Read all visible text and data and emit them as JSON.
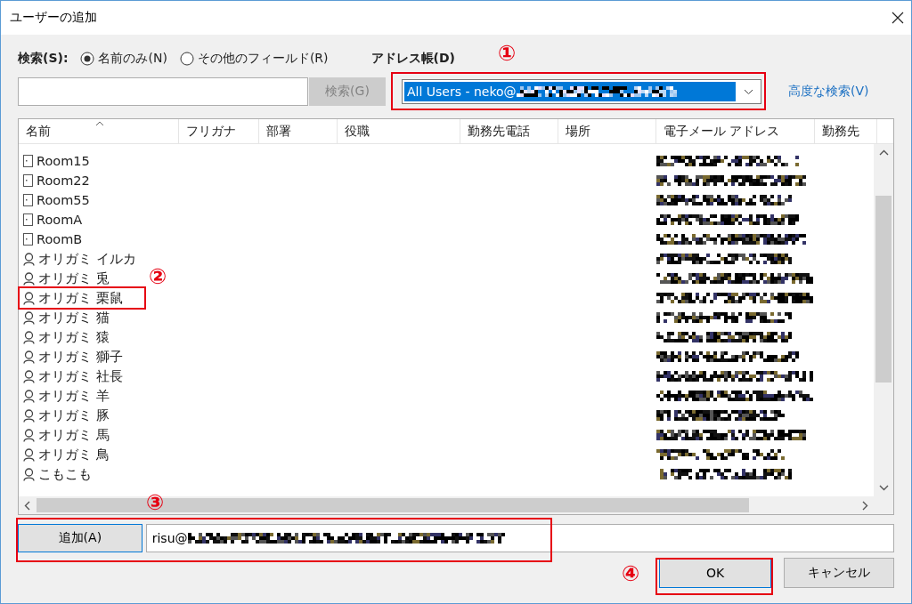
{
  "window": {
    "title": "ユーザーの追加"
  },
  "search": {
    "label": "検索(S):",
    "options": [
      {
        "label": "名前のみ(N)",
        "selected": true
      },
      {
        "label": "その他のフィールド(R)",
        "selected": false
      }
    ],
    "button": {
      "label": "検索(G)",
      "disabled": true
    }
  },
  "address_book": {
    "label": "アドレス帳(D)",
    "value": "All Users - neko@"
  },
  "advanced_search": "高度な検索(V)",
  "table": {
    "columns": [
      "名前",
      "フリガナ",
      "部署",
      "役職",
      "勤務先電話",
      "場所",
      "電子メール アドレス",
      "勤務先"
    ],
    "rows": [
      {
        "kind": "room",
        "name": "Room15"
      },
      {
        "kind": "room",
        "name": "Room22"
      },
      {
        "kind": "room",
        "name": "Room55"
      },
      {
        "kind": "room",
        "name": "RoomA"
      },
      {
        "kind": "room",
        "name": "RoomB"
      },
      {
        "kind": "person",
        "name": "オリガミ イルカ"
      },
      {
        "kind": "person",
        "name": "オリガミ 兎"
      },
      {
        "kind": "person",
        "name": "オリガミ 栗鼠"
      },
      {
        "kind": "person",
        "name": "オリガミ 猫"
      },
      {
        "kind": "person",
        "name": "オリガミ 猿"
      },
      {
        "kind": "person",
        "name": "オリガミ 獅子"
      },
      {
        "kind": "person",
        "name": "オリガミ 社長"
      },
      {
        "kind": "person",
        "name": "オリガミ 羊"
      },
      {
        "kind": "person",
        "name": "オリガミ 豚"
      },
      {
        "kind": "person",
        "name": "オリガミ 馬"
      },
      {
        "kind": "person",
        "name": "オリガミ 鳥"
      },
      {
        "kind": "person",
        "name": "こもこも"
      }
    ]
  },
  "add": {
    "button": "追加(A)",
    "value": "risu@"
  },
  "buttons": [
    {
      "label": "OK",
      "kind": "default"
    },
    {
      "label": "キャンセル",
      "kind": "normal"
    }
  ],
  "annotations": [
    {
      "label": "①"
    },
    {
      "label": "②"
    },
    {
      "label": "③"
    },
    {
      "label": "④"
    }
  ]
}
